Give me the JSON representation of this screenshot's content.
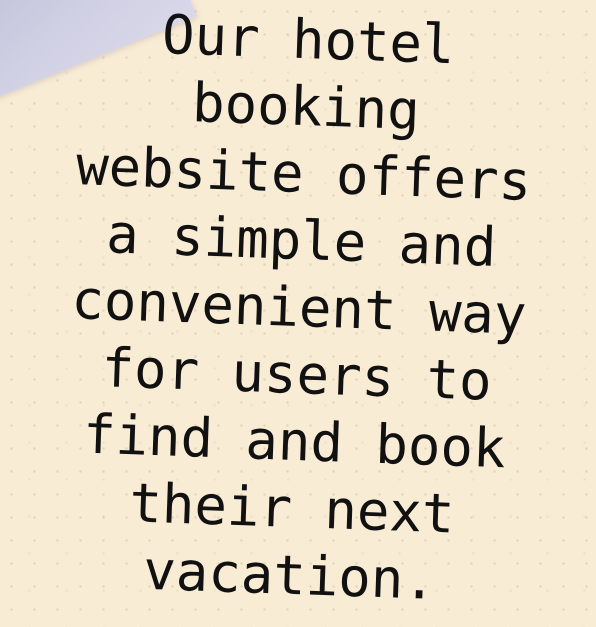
{
  "colors": {
    "background": "#f9ecd4",
    "corner_shape": "#c3c3dc",
    "text": "#111111"
  },
  "message": {
    "text": "Our hotel\nbooking\nwebsite offers\na simple and\nconvenient way\nfor users to\nfind and book\ntheir next\nvacation."
  }
}
